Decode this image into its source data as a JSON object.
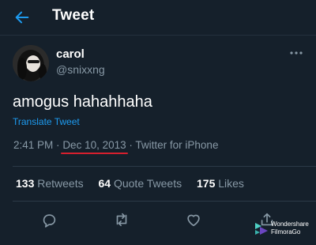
{
  "header": {
    "title": "Tweet",
    "back_icon": "back-arrow-icon"
  },
  "tweet": {
    "display_name": "carol",
    "handle": "@snixxng",
    "text": "amogus hahahhaha",
    "translate_label": "Translate Tweet",
    "time": "2:41 PM",
    "date": "Dec 10, 2013",
    "source": "Twitter for iPhone",
    "separator": "·"
  },
  "stats": {
    "retweets_count": "133",
    "retweets_label": "Retweets",
    "quotes_count": "64",
    "quotes_label": "Quote Tweets",
    "likes_count": "175",
    "likes_label": "Likes"
  },
  "watermark": {
    "line1": "Wondershare",
    "line2": "FilmoraGo"
  },
  "colors": {
    "background": "#15202b",
    "accent": "#1d9bf0",
    "secondary_text": "#8899a6",
    "highlight_underline": "#d61f2e"
  }
}
